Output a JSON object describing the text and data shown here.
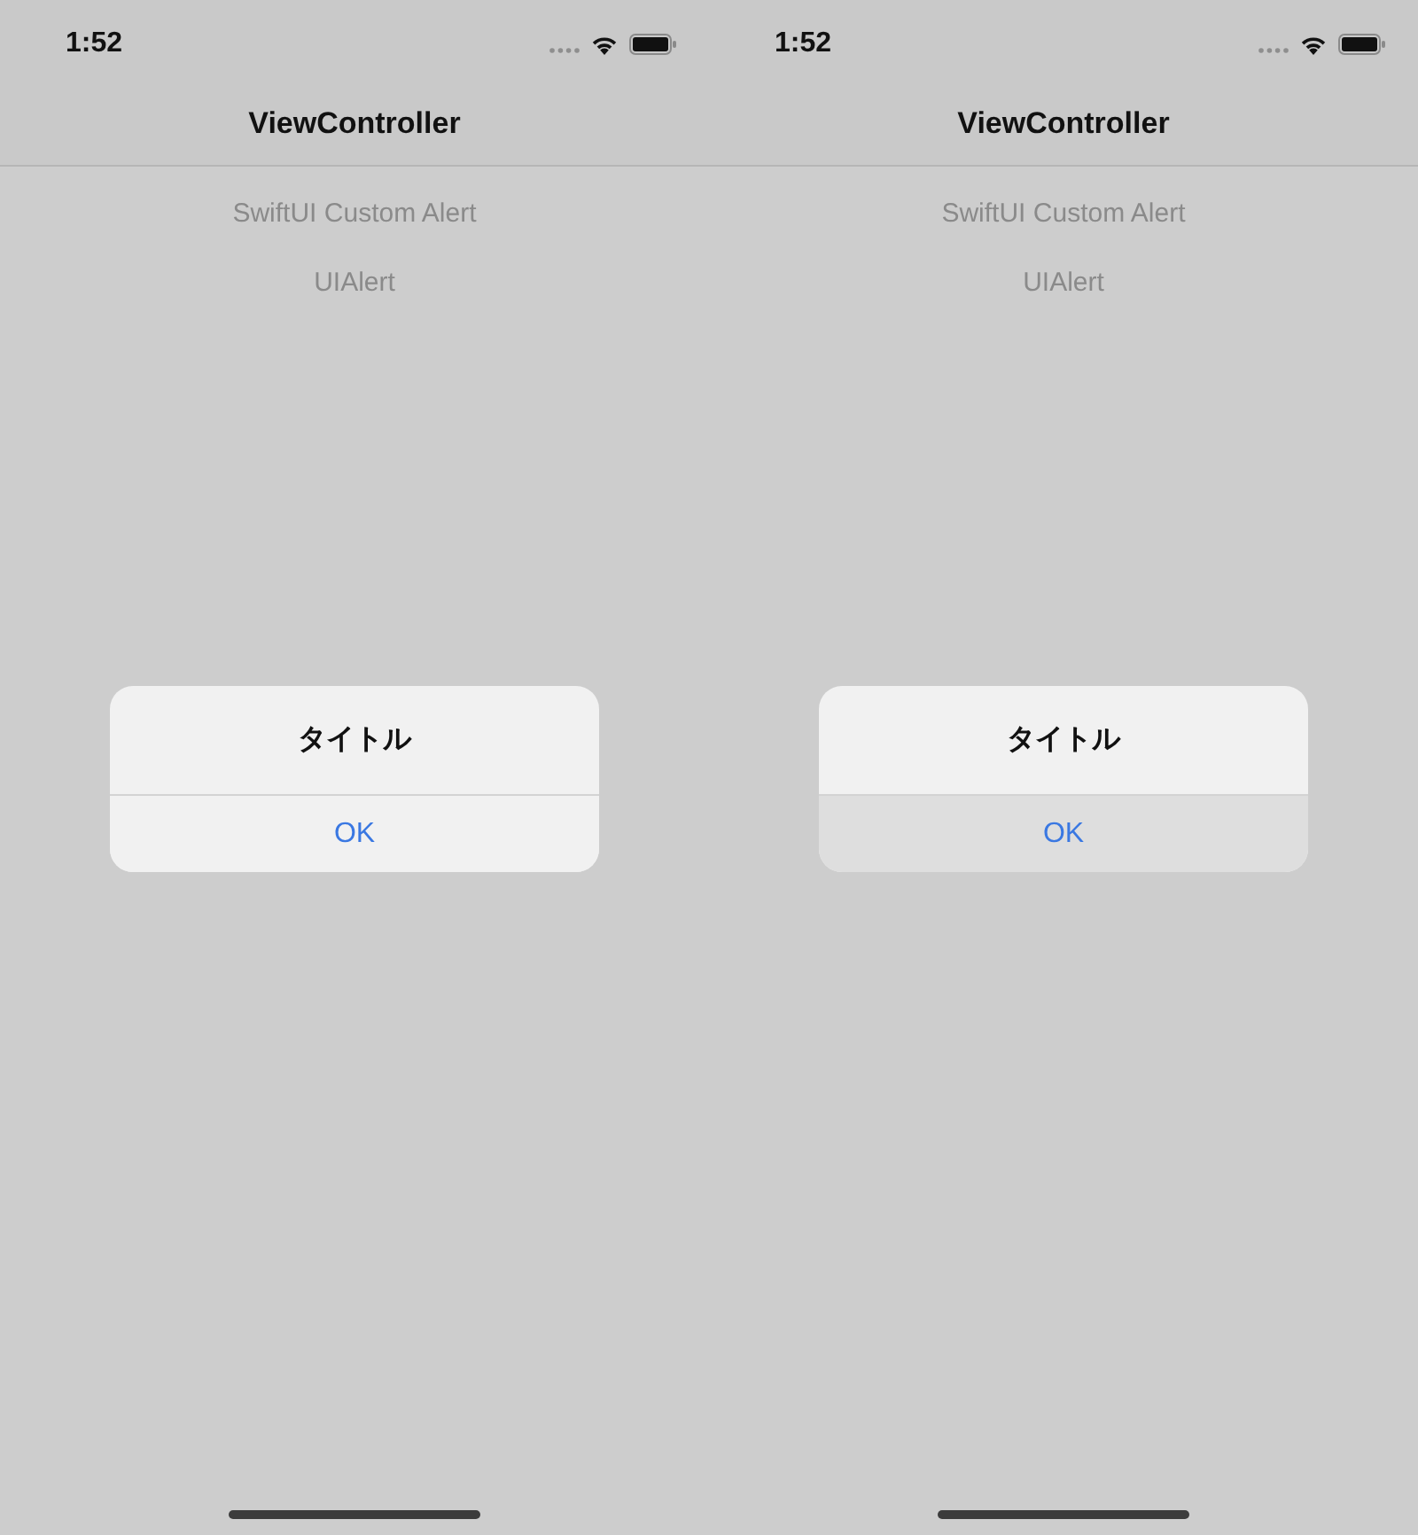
{
  "screens": [
    {
      "status_bar": {
        "time": "1:52"
      },
      "nav_bar": {
        "title": "ViewController"
      },
      "buttons": [
        "SwiftUI Custom Alert",
        "UIAlert"
      ],
      "alert": {
        "title": "タイトル",
        "actions": [
          {
            "label": "OK",
            "pressed": false
          }
        ]
      }
    },
    {
      "status_bar": {
        "time": "1:52"
      },
      "nav_bar": {
        "title": "ViewController"
      },
      "buttons": [
        "SwiftUI Custom Alert",
        "UIAlert"
      ],
      "alert": {
        "title": "タイトル",
        "actions": [
          {
            "label": "OK",
            "pressed": true
          }
        ]
      }
    }
  ]
}
